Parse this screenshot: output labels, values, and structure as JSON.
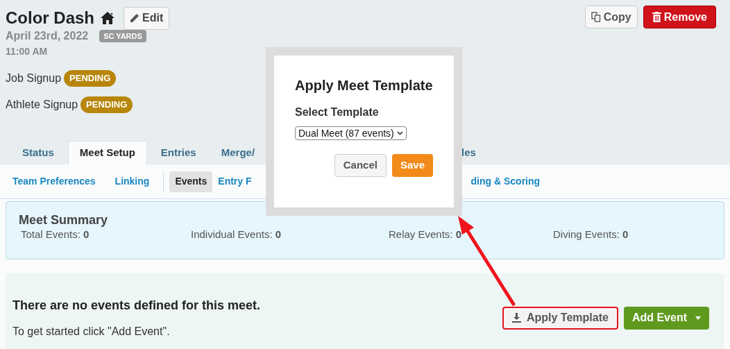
{
  "meet": {
    "title": "Color Dash",
    "edit_label": "Edit",
    "date": "April 23rd, 2022",
    "course": "SC YARDS",
    "time": "11:00 AM",
    "copy_label": "Copy",
    "remove_label": "Remove"
  },
  "signups": [
    {
      "label": "Job Signup",
      "status": "PENDING"
    },
    {
      "label": "Athlete Signup",
      "status": "PENDING"
    }
  ],
  "tabs": [
    {
      "label": "Status",
      "selected": false
    },
    {
      "label": "Meet Setup",
      "selected": true
    },
    {
      "label": "Entries",
      "selected": false
    },
    {
      "label": "Merge/",
      "selected": false
    },
    {
      "label": "les",
      "selected": false
    }
  ],
  "subtabs": [
    {
      "label": "Team Preferences",
      "selected": false
    },
    {
      "label": "Linking",
      "selected": false
    },
    {
      "label": "Events",
      "selected": true
    },
    {
      "label": "Entry F",
      "selected": false
    },
    {
      "label": "ding & Scoring",
      "selected": false
    }
  ],
  "summary": {
    "title": "Meet Summary",
    "stats": [
      {
        "label": "Total Events:",
        "value": "0"
      },
      {
        "label": "Individual Events:",
        "value": "0"
      },
      {
        "label": "Relay Events:",
        "value": "0"
      },
      {
        "label": "Diving Events:",
        "value": "0"
      }
    ]
  },
  "empty_state": {
    "heading": "There are no events defined for this meet.",
    "hint": "To get started click \"Add Event\".",
    "apply_label": "Apply Template",
    "add_label": "Add Event"
  },
  "dialog": {
    "title": "Apply Meet Template",
    "field_label": "Select Template",
    "value": "Dual Meet (87 events)",
    "cancel_label": "Cancel",
    "save_label": "Save"
  }
}
